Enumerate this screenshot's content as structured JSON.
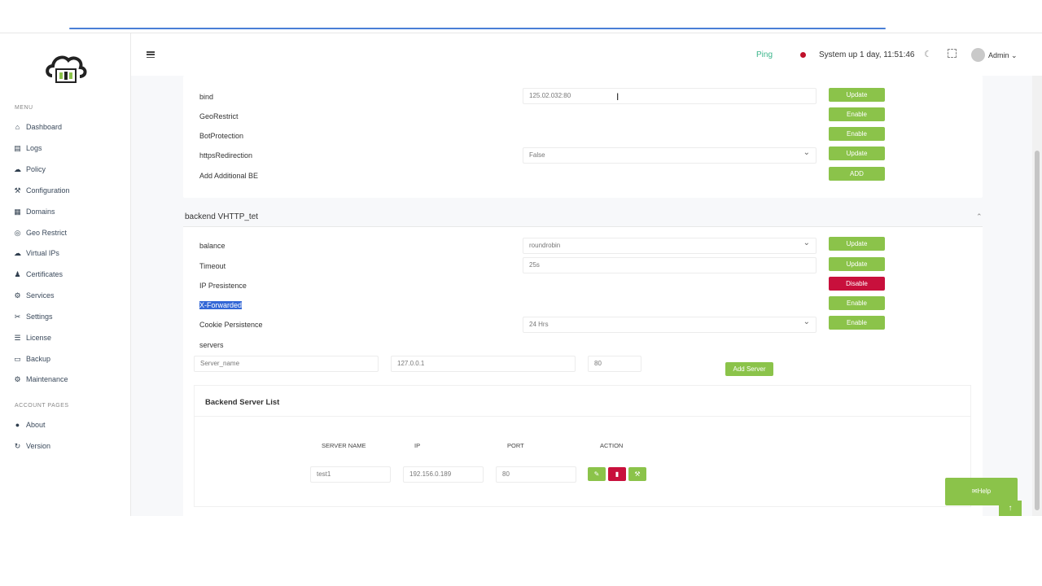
{
  "sidebar": {
    "menu_label": "MENU",
    "items": [
      {
        "label": "Dashboard",
        "icon": "home-icon"
      },
      {
        "label": "Logs",
        "icon": "file-icon"
      },
      {
        "label": "Policy",
        "icon": "cloud-icon"
      },
      {
        "label": "Configuration",
        "icon": "wrench-icon"
      },
      {
        "label": "Domains",
        "icon": "server-icon"
      },
      {
        "label": "Geo Restrict",
        "icon": "globe-icon"
      },
      {
        "label": "Virtual IPs",
        "icon": "cloud-icon"
      },
      {
        "label": "Certificates",
        "icon": "user-icon"
      },
      {
        "label": "Services",
        "icon": "gear-icon"
      },
      {
        "label": "Settings",
        "icon": "tools-icon"
      },
      {
        "label": "License",
        "icon": "list-icon"
      },
      {
        "label": "Backup",
        "icon": "drive-icon"
      },
      {
        "label": "Maintenance",
        "icon": "gears-icon"
      }
    ],
    "account_label": "ACCOUNT PAGES",
    "account_items": [
      {
        "label": "About",
        "icon": "info-icon"
      },
      {
        "label": "Version",
        "icon": "refresh-icon"
      }
    ]
  },
  "header": {
    "ping": "Ping",
    "uptime": "System up 1 day, 11:51:46",
    "user": "Admin"
  },
  "frontend": {
    "rows": [
      {
        "label": "bind",
        "value": "125.02.032:80",
        "button": "Update"
      },
      {
        "label": "GeoRestrict",
        "button": "Enable"
      },
      {
        "label": "BotProtection",
        "button": "Enable"
      },
      {
        "label": "httpsRedirection",
        "value": "False",
        "button": "Update"
      },
      {
        "label": "Add Additional BE",
        "button": "ADD"
      }
    ]
  },
  "backend": {
    "title": "backend VHTTP_tet",
    "rows": [
      {
        "label": "balance",
        "value": "roundrobin",
        "button": "Update"
      },
      {
        "label": "Timeout",
        "value": "25s",
        "button": "Update"
      },
      {
        "label": "IP Presistence",
        "button": "Disable"
      },
      {
        "label": "X-Forwarded",
        "button": "Enable"
      },
      {
        "label": "Cookie Persistence",
        "value": "24 Hrs",
        "button": "Enable"
      }
    ],
    "servers_label": "servers",
    "server_name_placeholder": "Server_name",
    "server_ip": "127.0.0.1",
    "server_port": "80",
    "add_server": "Add Server",
    "list_title": "Backend Server List",
    "columns": [
      "SERVER NAME",
      "IP",
      "PORT",
      "ACTION"
    ],
    "server_rows": [
      {
        "name": "test1",
        "ip": "192.156.0.189",
        "port": "80"
      }
    ]
  },
  "help": "Help",
  "colors": {
    "accent": "#8bc34a",
    "danger": "#c8103c",
    "ping": "#3bb58b"
  }
}
